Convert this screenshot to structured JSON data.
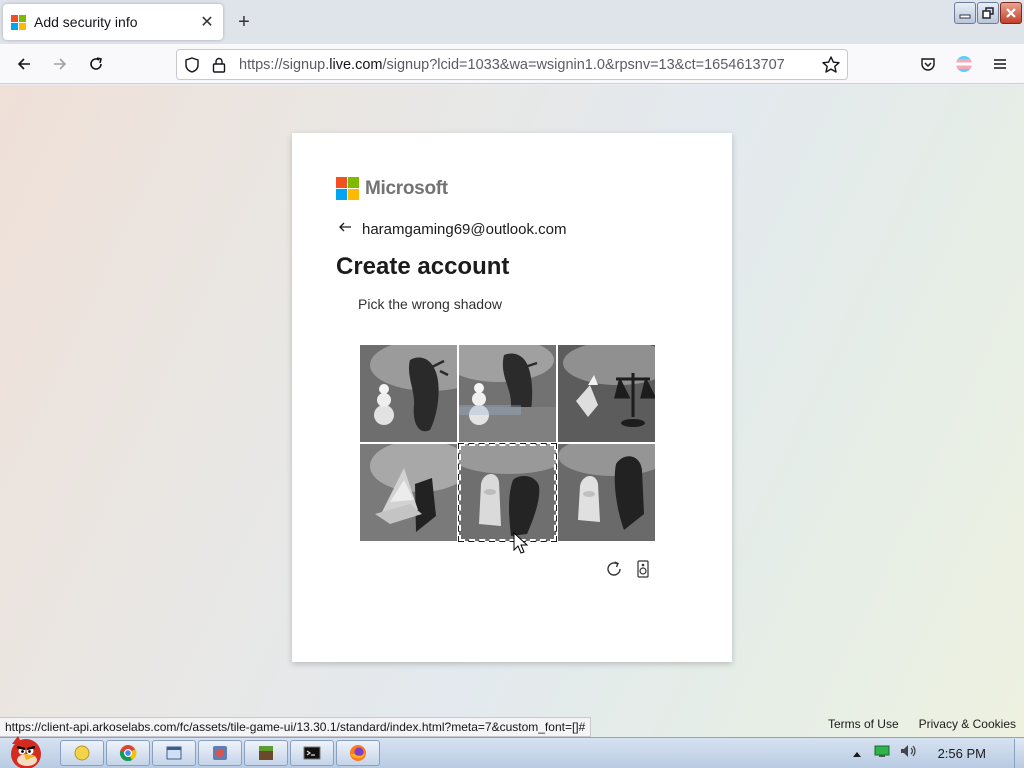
{
  "browser": {
    "tab": {
      "title": "Add security info",
      "close_glyph": "✕"
    },
    "new_tab_glyph": "+",
    "url": {
      "prefix": "https://signup.",
      "host": "live.com",
      "rest": "/signup?lcid=1033&wa=wsignin1.0&rpsnv=13&ct=1654613707"
    },
    "status_url": "https://client-api.arkoselabs.com/fc/assets/tile-game-ui/13.30.1/standard/index.html?meta=7&custom_font=[]#"
  },
  "card": {
    "brand": "Microsoft",
    "email": "haramgaming69@outlook.com",
    "title": "Create account",
    "prompt": "Pick the wrong shadow",
    "selected_tile_index": 4
  },
  "footer": {
    "terms": "Terms of Use",
    "privacy": "Privacy & Cookies"
  },
  "taskbar": {
    "clock": "2:56 PM"
  },
  "colors": {
    "ms_red": "#f25022",
    "ms_green": "#7fba00",
    "ms_blue": "#00a4ef",
    "ms_yellow": "#ffb900"
  }
}
